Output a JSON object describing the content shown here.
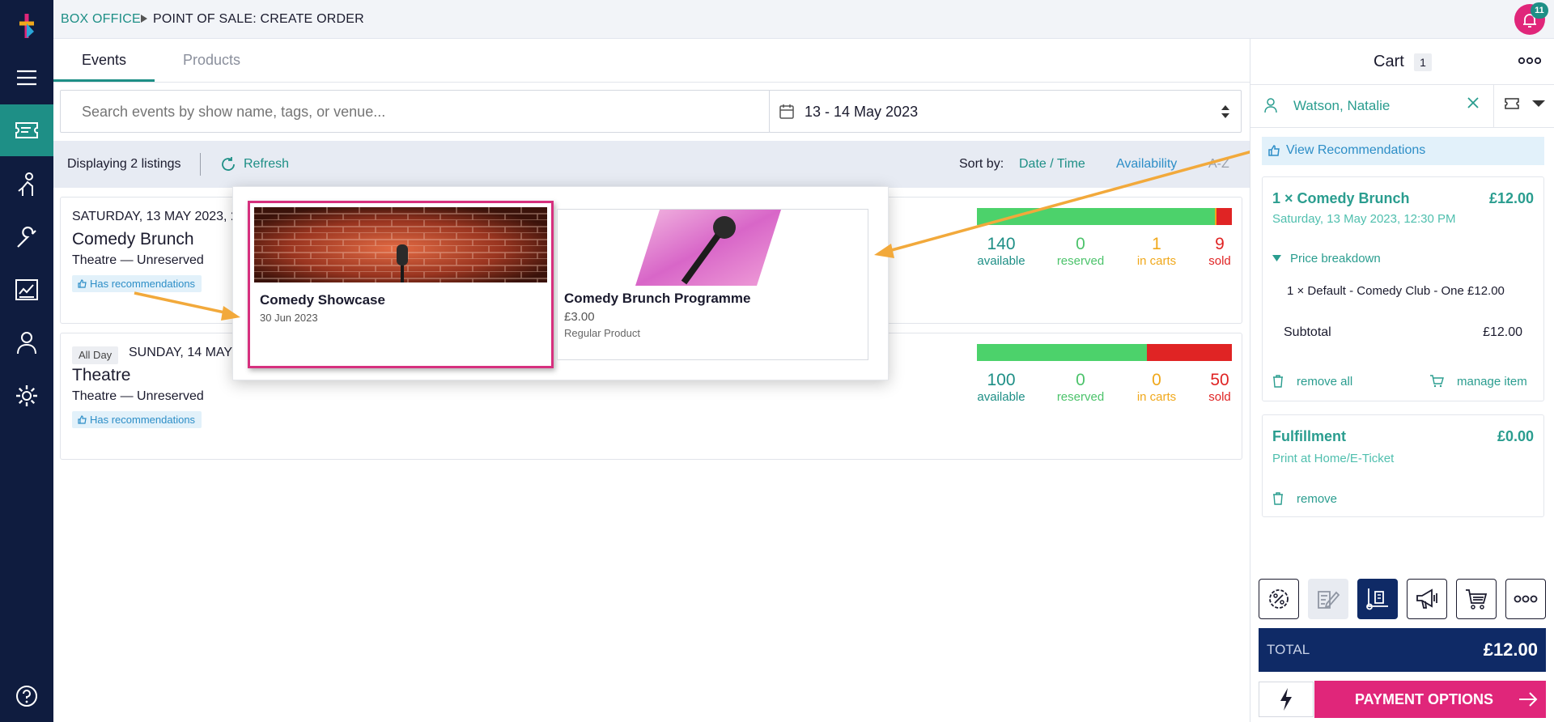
{
  "breadcrumb": {
    "parent": "BOX OFFICE",
    "current": "POINT OF SALE: CREATE ORDER"
  },
  "notifications": {
    "count": "11"
  },
  "nav": {
    "icons": [
      "logo-icon",
      "menu-icon",
      "ticket-icon",
      "person-icon",
      "wrench-icon",
      "report-icon",
      "user-icon",
      "settings-icon",
      "help-icon"
    ]
  },
  "tabs": [
    {
      "label": "Events",
      "active": true
    },
    {
      "label": "Products",
      "active": false
    }
  ],
  "search": {
    "placeholder": "Search events by show name, tags, or venue...",
    "value": ""
  },
  "date_range": {
    "value": "13 - 14 May 2023"
  },
  "listing": {
    "count_text": "Displaying 2 listings",
    "refresh_label": "Refresh",
    "sort_label": "Sort by:",
    "sort_options": [
      "Date / Time",
      "Availability",
      "A-Z"
    ],
    "sort_active": "Date / Time"
  },
  "events": [
    {
      "date": "SATURDAY, 13 MAY 2023,",
      "time": "12",
      "all_day": "",
      "title": "Comedy Brunch",
      "venue": "Theatre — Unreserved",
      "badge": "Has recommendations",
      "stats": {
        "available": "140",
        "reserved": "0",
        "in_carts": "1",
        "sold": "9"
      },
      "capacity": {
        "available": 140,
        "reserved": 0,
        "in_carts": 1,
        "sold": 9
      }
    },
    {
      "date": "SUNDAY, 14 MAY 2",
      "time": "",
      "all_day": "All Day",
      "title": "Theatre",
      "venue": "Theatre — Unreserved",
      "badge": "Has recommendations",
      "stats": {
        "available": "100",
        "reserved": "0",
        "in_carts": "0",
        "sold": "50"
      },
      "capacity": {
        "available": 100,
        "reserved": 0,
        "in_carts": 0,
        "sold": 50
      }
    }
  ],
  "stat_labels": {
    "available": "available",
    "reserved": "reserved",
    "in_carts": "in carts",
    "sold": "sold"
  },
  "recommendations": [
    {
      "title": "Comedy Showcase",
      "date": "30 Jun 2023",
      "price": "",
      "type": "",
      "highlighted": true
    },
    {
      "title": "Comedy Brunch Programme",
      "date": "",
      "price": "£3.00",
      "type": "Regular Product",
      "highlighted": false
    }
  ],
  "cart": {
    "title": "Cart",
    "count": "1",
    "customer": "Watson, Natalie",
    "view_recommendations": "View Recommendations",
    "item": {
      "title": "1 × Comedy Brunch",
      "price": "£12.00",
      "datetime": "Saturday, 13 May 2023, 12:30 PM",
      "breakdown_label": "Price breakdown",
      "breakdown_line": "1 × Default - Comedy Club - One £12.00",
      "subtotal_label": "Subtotal",
      "subtotal": "£12.00",
      "remove_all": "remove all",
      "manage_item": "manage item"
    },
    "fulfillment": {
      "title": "Fulfillment",
      "price": "£0.00",
      "method": "Print at Home/E-Ticket",
      "remove": "remove"
    },
    "toolbar_icons": [
      "discount-icon",
      "notes-icon",
      "delivery-icon",
      "megaphone-icon",
      "cart-icon",
      "more-icon"
    ],
    "total_label": "TOTAL",
    "total": "£12.00",
    "payment_label": "PAYMENT OPTIONS"
  },
  "colors": {
    "nav_bg": "#0f1c3f",
    "accent_teal": "#1e8f86",
    "accent_pink": "#e0267a",
    "total_bg": "#0f2a66",
    "available_green": "#4cd26b",
    "sold_red": "#e02424",
    "in_carts_orange": "#f0a81b"
  }
}
